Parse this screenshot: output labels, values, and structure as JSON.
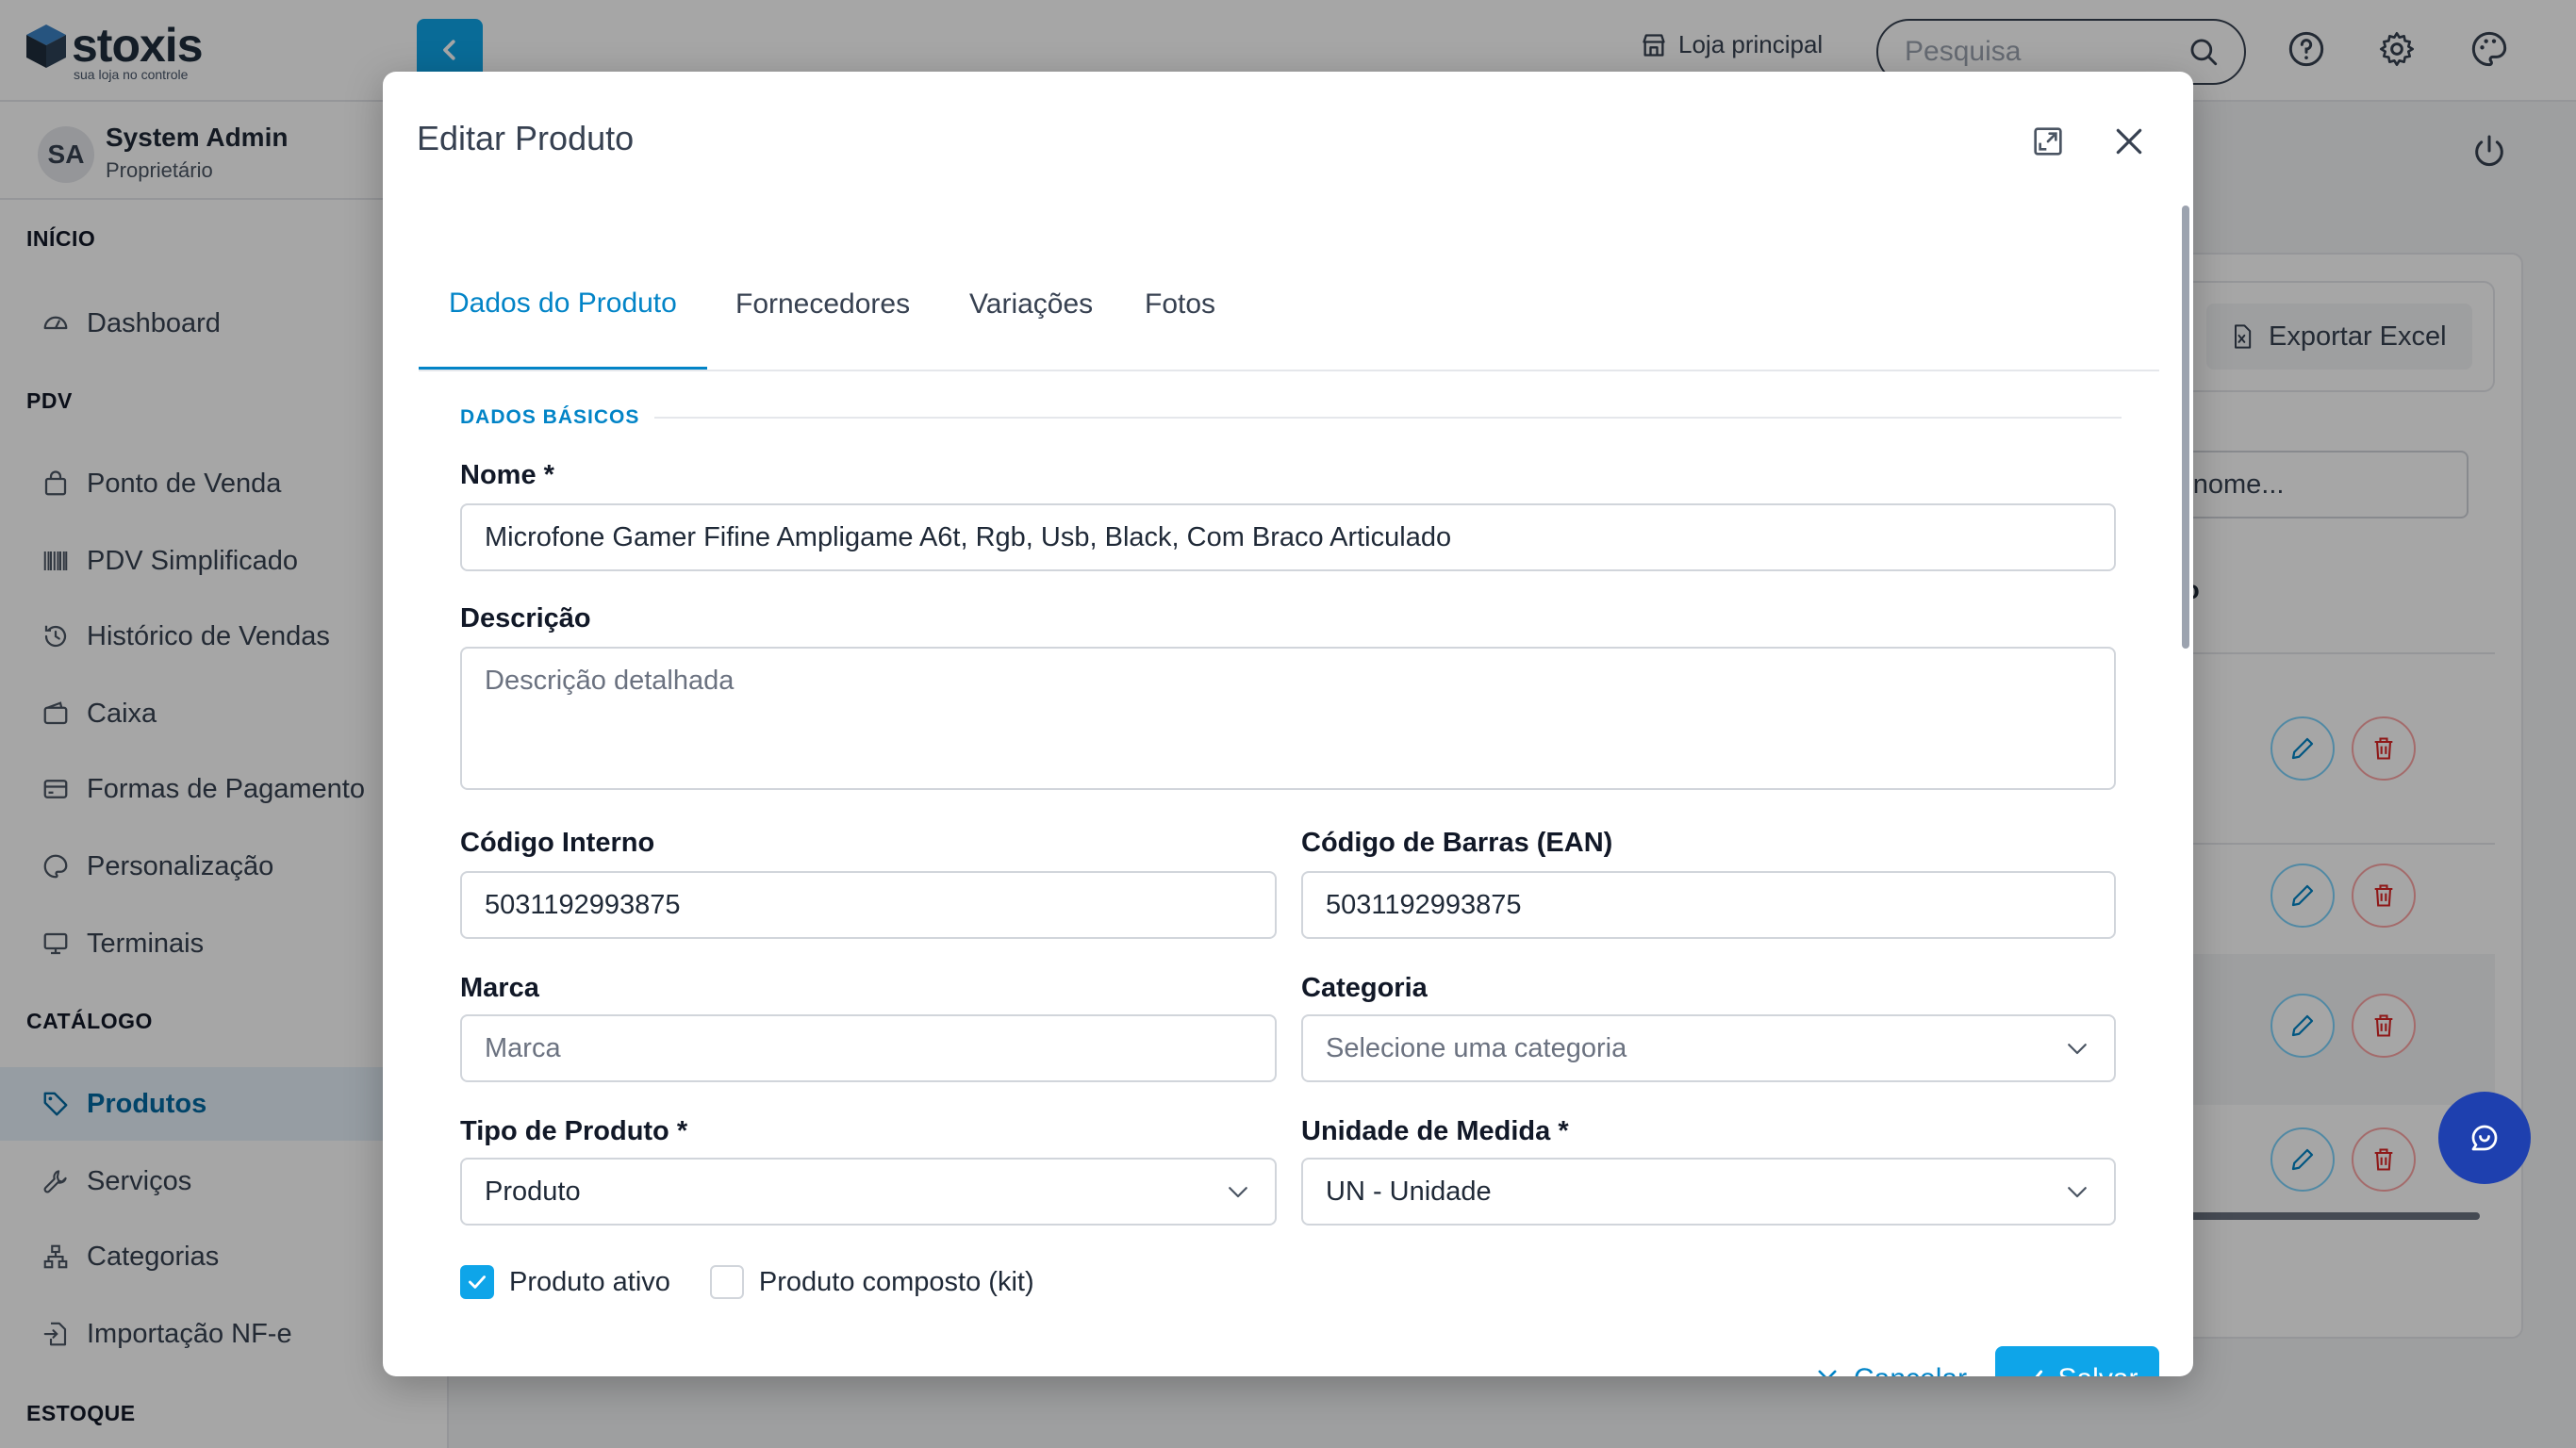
{
  "app": {
    "logo_name": "stoxis",
    "logo_tagline": "sua loja no controle",
    "store_label": "Loja principal",
    "search_placeholder": "Pesquisa"
  },
  "user": {
    "initials": "SA",
    "name": "System Admin",
    "role": "Proprietário"
  },
  "sidebar": {
    "sections": {
      "inicio": "INÍCIO",
      "pdv": "PDV",
      "catalogo": "CATÁLOGO",
      "estoque": "ESTOQUE"
    },
    "items": {
      "dashboard": "Dashboard",
      "ponto_venda": "Ponto de Venda",
      "pdv_simplificado": "PDV Simplificado",
      "historico": "Histórico de Vendas",
      "caixa": "Caixa",
      "formas_pagamento": "Formas de Pagamento",
      "personalizacao": "Personalização",
      "terminais": "Terminais",
      "produtos": "Produtos",
      "servicos": "Serviços",
      "categorias": "Categorias",
      "importacao": "Importação NF-e"
    },
    "active": "produtos"
  },
  "background": {
    "export_label": "Exportar Excel",
    "filter_text": "r nome...",
    "column_header_fragment": "ão"
  },
  "modal": {
    "title": "Editar Produto",
    "tabs": [
      "Dados do Produto",
      "Fornecedores",
      "Variações",
      "Fotos"
    ],
    "active_tab": 0,
    "section_label": "DADOS BÁSICOS",
    "fields": {
      "nome": {
        "label": "Nome *",
        "value": "Microfone Gamer Fifine Ampligame A6t, Rgb, Usb, Black, Com Braco Articulado"
      },
      "descricao": {
        "label": "Descrição",
        "placeholder": "Descrição detalhada"
      },
      "codigo_interno": {
        "label": "Código Interno",
        "value": "5031192993875"
      },
      "codigo_barras": {
        "label": "Código de Barras (EAN)",
        "value": "5031192993875"
      },
      "marca": {
        "label": "Marca",
        "placeholder": "Marca"
      },
      "categoria": {
        "label": "Categoria",
        "placeholder": "Selecione uma categoria"
      },
      "tipo_produto": {
        "label": "Tipo de Produto *",
        "value": "Produto"
      },
      "unidade_medida": {
        "label": "Unidade de Medida *",
        "value": "UN - Unidade"
      }
    },
    "checkboxes": {
      "ativo": {
        "label": "Produto ativo",
        "checked": true
      },
      "composto": {
        "label": "Produto composto (kit)",
        "checked": false
      }
    },
    "buttons": {
      "cancel": "Cancelar",
      "save": "Salvar"
    }
  },
  "colors": {
    "accent": "#0ea5e9",
    "accent_text": "#0284c7",
    "chat_fab": "#1e40af",
    "delete_red": "#dc2626"
  }
}
